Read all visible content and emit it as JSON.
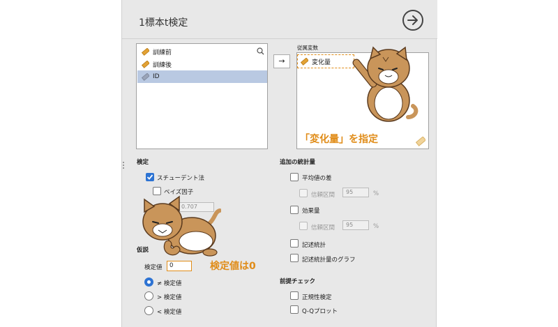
{
  "dialog": {
    "title": "1標本t検定",
    "go_icon": "arrow-circle-right"
  },
  "variables": {
    "search_icon": "magnifier",
    "items": [
      {
        "label": "訓練前",
        "icon": "ruler"
      },
      {
        "label": "訓練後",
        "icon": "ruler"
      },
      {
        "label": "ID",
        "icon": "ruler-gray"
      }
    ]
  },
  "move_button": "→",
  "dependent": {
    "title": "従属変数",
    "item": "変化量"
  },
  "annotations": {
    "dep_caption": "「変化量」を指定",
    "test_value_caption": "検定値は0"
  },
  "tests": {
    "title": "検定",
    "student": "スチューデント法",
    "bayes": "ベイズ因子",
    "prior_value": "0.707"
  },
  "hypothesis": {
    "title": "仮説",
    "test_value_label": "検定値",
    "test_value": "0",
    "options": [
      "≠ 検定値",
      "> 検定値",
      "< 検定値"
    ]
  },
  "additional_stats": {
    "title": "追加の統計量",
    "mean_diff": "平均値の差",
    "ci1_label": "信頼区間",
    "ci1_value": "95",
    "ci1_unit": "%",
    "effect_size": "効果量",
    "ci2_label": "信頼区間",
    "ci2_value": "95",
    "ci2_unit": "%",
    "descriptives": "記述統計",
    "desc_plot": "記述統計量のグラフ"
  },
  "assumptions": {
    "title": "前提チェック",
    "normality": "正規性検定",
    "qq": "Q-Qプロット"
  },
  "colors": {
    "accent": "#2d73d3",
    "annotation": "#e08c18",
    "selected_row": "#b9c9e2",
    "cat_body": "#c9955a"
  }
}
